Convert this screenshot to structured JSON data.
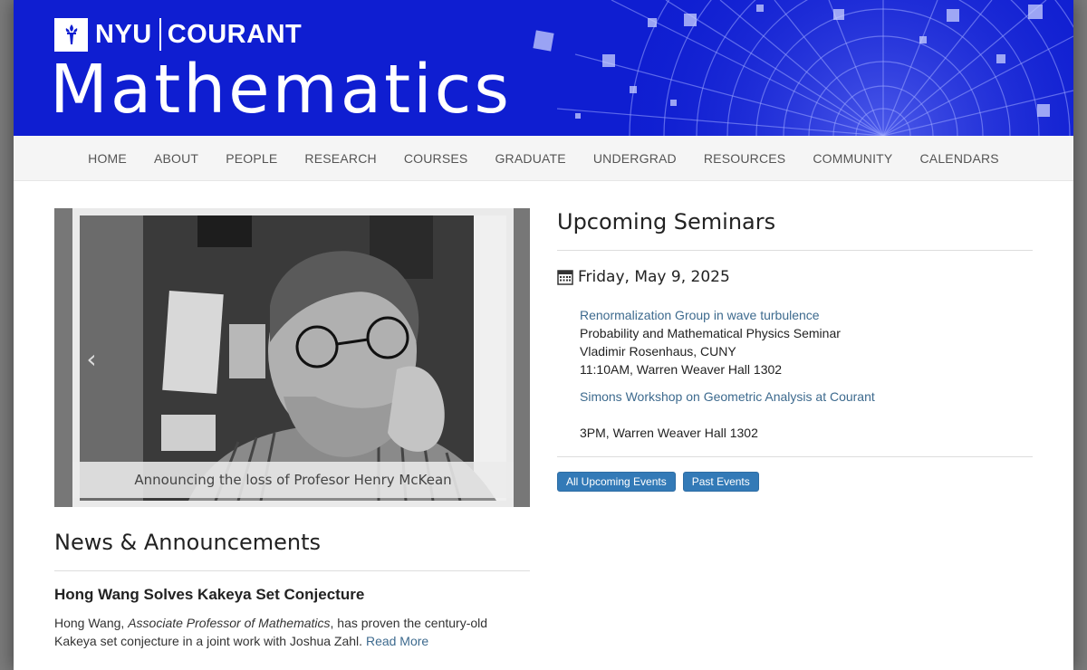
{
  "header": {
    "logo_nyu": "NYU",
    "logo_courant": "COURANT",
    "site_title": "Mathematics",
    "brand_color": "#0f1ed1"
  },
  "nav": {
    "items": [
      {
        "label": "HOME"
      },
      {
        "label": "ABOUT"
      },
      {
        "label": "PEOPLE"
      },
      {
        "label": "RESEARCH"
      },
      {
        "label": "COURSES"
      },
      {
        "label": "GRADUATE"
      },
      {
        "label": "UNDERGRAD"
      },
      {
        "label": "RESOURCES"
      },
      {
        "label": "COMMUNITY"
      },
      {
        "label": "CALENDARS"
      }
    ]
  },
  "carousel": {
    "caption": "Announcing the loss of Profesor Henry McKean",
    "prev_icon": "chevron-left-icon"
  },
  "news": {
    "title": "News & Announcements",
    "headline": "Hong Wang Solves Kakeya Set Conjecture",
    "body_start": "Hong Wang, ",
    "body_role": "Associate Professor of Mathematics",
    "body_end": ", has proven the century-old Kakeya set conjecture in a joint work with Joshua Zahl. ",
    "read_more": "Read More"
  },
  "seminars": {
    "title": "Upcoming Seminars",
    "date_icon": "calendar-icon",
    "date": "Friday, May 9, 2025",
    "events": [
      {
        "title": "Renormalization Group in wave turbulence",
        "series": "Probability and Mathematical Physics Seminar",
        "speaker": "Vladimir Rosenhaus, CUNY",
        "time_place": "11:10AM, Warren Weaver Hall 1302"
      },
      {
        "title": "Simons Workshop on Geometric Analysis at Courant",
        "series": "",
        "speaker": "",
        "time_place": "3PM, Warren Weaver Hall 1302"
      }
    ],
    "btn_all": "All Upcoming Events",
    "btn_past": "Past Events",
    "link_color": "#3d6a8e",
    "button_color": "#337ab7"
  }
}
